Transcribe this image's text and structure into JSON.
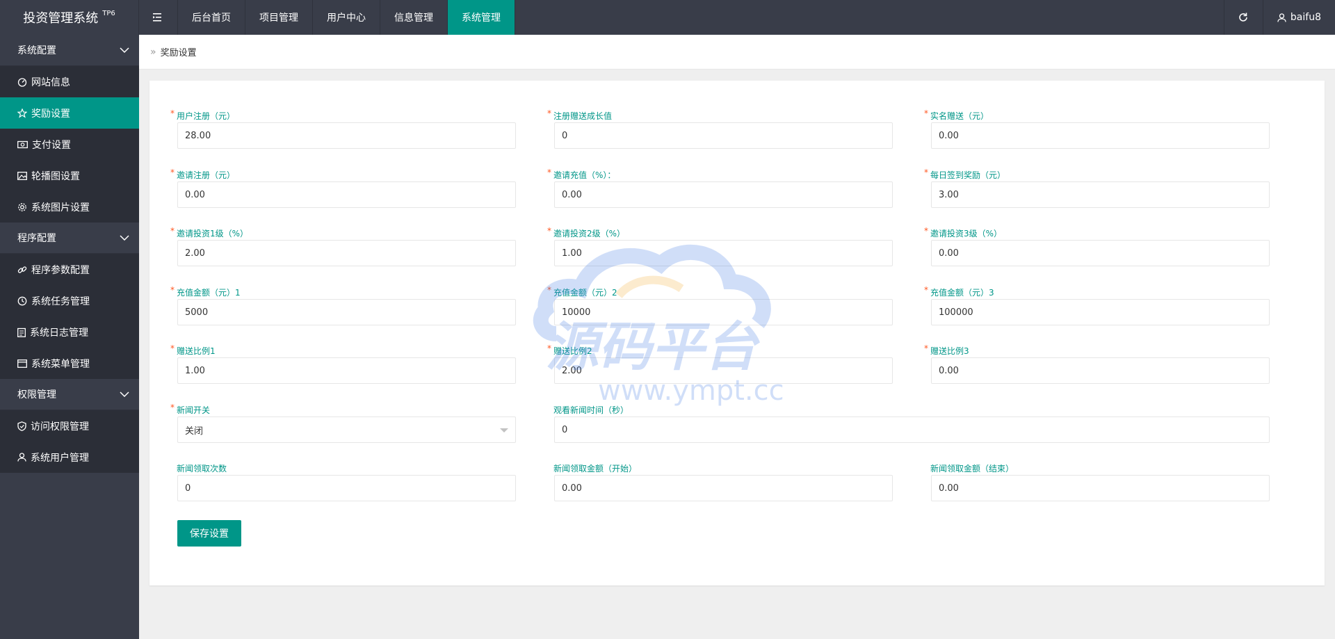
{
  "app": {
    "title": "投资管理系统",
    "badge": "TP6"
  },
  "topnav": {
    "items": [
      {
        "label": "后台首页",
        "active": false
      },
      {
        "label": "项目管理",
        "active": false
      },
      {
        "label": "用户中心",
        "active": false
      },
      {
        "label": "信息管理",
        "active": false
      },
      {
        "label": "系统管理",
        "active": true
      }
    ],
    "user": "baifu8"
  },
  "sidebar": {
    "groups": [
      {
        "title": "系统配置",
        "items": [
          "网站信息",
          "奖励设置",
          "支付设置",
          "轮播图设置",
          "系统图片设置"
        ],
        "active": "奖励设置"
      },
      {
        "title": "程序配置",
        "items": [
          "程序参数配置",
          "系统任务管理",
          "系统日志管理",
          "系统菜单管理"
        ]
      },
      {
        "title": "权限管理",
        "items": [
          "访问权限管理",
          "系统用户管理"
        ]
      }
    ]
  },
  "breadcrumb": {
    "current": "奖励设置"
  },
  "form": {
    "rows": [
      [
        {
          "label": "用户注册（元）",
          "value": "28.00",
          "required": true
        },
        {
          "label": "注册赠送成长值",
          "value": "0",
          "required": true
        },
        {
          "label": "实名赠送（元）",
          "value": "0.00",
          "required": true
        }
      ],
      [
        {
          "label": "邀请注册（元）",
          "value": "0.00",
          "required": true
        },
        {
          "label": "邀请充值（%）：",
          "value": "0.00",
          "required": true
        },
        {
          "label": "每日签到奖励（元）",
          "value": "3.00",
          "required": true
        }
      ],
      [
        {
          "label": "邀请投资1级（%）",
          "value": "2.00",
          "required": true
        },
        {
          "label": "邀请投资2级（%）",
          "value": "1.00",
          "required": true
        },
        {
          "label": "邀请投资3级（%）",
          "value": "0.00",
          "required": true
        }
      ],
      [
        {
          "label": "充值金额（元）1",
          "value": "5000",
          "required": true
        },
        {
          "label": "充值金额（元）2",
          "value": "10000",
          "required": true
        },
        {
          "label": "充值金额（元）3",
          "value": "100000",
          "required": true
        }
      ],
      [
        {
          "label": "赠送比例1",
          "value": "1.00",
          "required": true
        },
        {
          "label": "赠送比例2",
          "value": "2.00",
          "required": true
        },
        {
          "label": "赠送比例3",
          "value": "0.00",
          "required": true
        }
      ]
    ],
    "news_switch": {
      "label": "新闻开关",
      "value": "关闭",
      "required": true
    },
    "news_watch_time": {
      "label": "观看新闻时间（秒）",
      "value": "0"
    },
    "news_claim_count": {
      "label": "新闻领取次数",
      "value": "0"
    },
    "news_amount_start": {
      "label": "新闻领取金额（开始）",
      "value": "0.00"
    },
    "news_amount_end": {
      "label": "新闻领取金额（结束）",
      "value": "0.00"
    },
    "save_label": "保存设置",
    "required_mark": "*"
  },
  "watermark": {
    "title": "源码平台",
    "url": "www.ympt.cc"
  },
  "colors": {
    "accent": "#009688",
    "header": "#393d49",
    "sidebar_item": "#2b2e37",
    "label": "#009688",
    "required": "#ff5722"
  }
}
